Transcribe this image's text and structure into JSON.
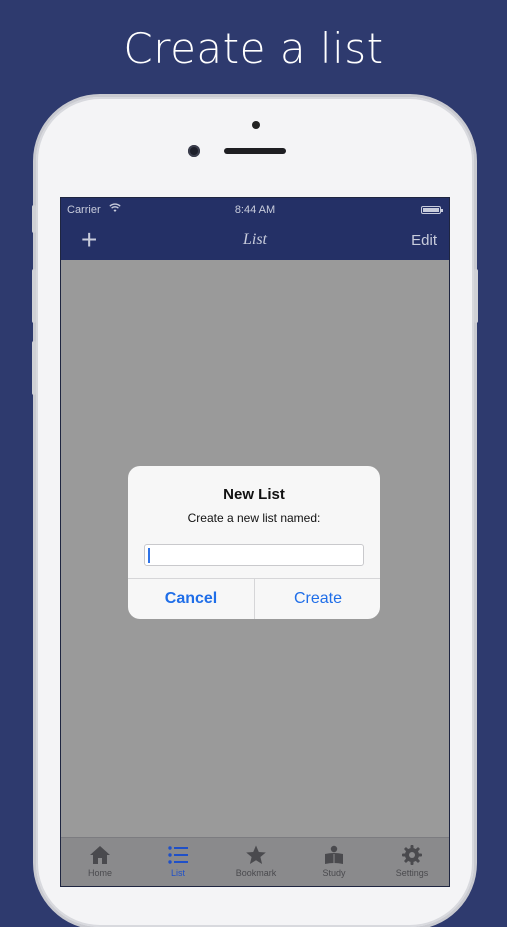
{
  "headline": "Create a list",
  "status_bar": {
    "carrier": "Carrier",
    "wifi_icon": "wifi-icon",
    "time": "8:44 AM",
    "battery_icon": "battery-icon"
  },
  "nav_bar": {
    "add_symbol": "+",
    "title": "List",
    "edit_label": "Edit"
  },
  "alert": {
    "title": "New List",
    "message": "Create a new list named:",
    "input_value": "",
    "cancel_label": "Cancel",
    "create_label": "Create"
  },
  "tab_bar": {
    "items": [
      {
        "label": "Home",
        "icon": "home-icon",
        "active": false
      },
      {
        "label": "List",
        "icon": "list-icon",
        "active": true
      },
      {
        "label": "Bookmark",
        "icon": "star-icon",
        "active": false
      },
      {
        "label": "Study",
        "icon": "study-icon",
        "active": false
      },
      {
        "label": "Settings",
        "icon": "gear-icon",
        "active": false
      }
    ]
  },
  "colors": {
    "background": "#2e3a6e",
    "nav_bar": "#243066",
    "accent": "#1f6ee8",
    "active_tab": "#1f50c8"
  }
}
